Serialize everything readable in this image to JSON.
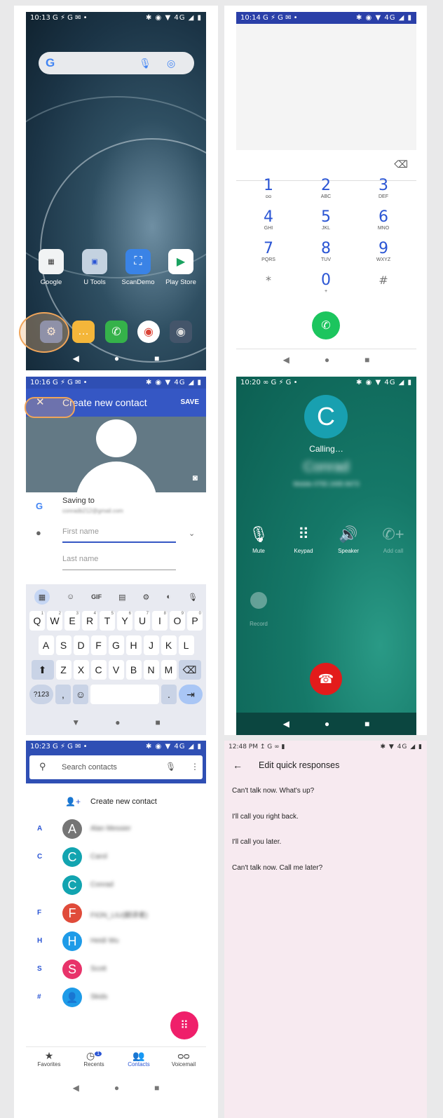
{
  "home": {
    "status": {
      "time": "10:13 G",
      "icons": "⚡ G ✉ •",
      "right": "✱ ◉ ▼ 4G ◢ ▮"
    },
    "apps": [
      {
        "label": "Google",
        "icon": "google-folder-icon"
      },
      {
        "label": "U Tools",
        "icon": "utools-folder-icon"
      },
      {
        "label": "ScanDemo",
        "icon": "scan-icon"
      },
      {
        "label": "Play Store",
        "icon": "play-store-icon"
      }
    ],
    "dock": [
      "settings-icon",
      "messages-icon",
      "phone-icon",
      "chrome-icon",
      "camera-icon"
    ]
  },
  "dialer": {
    "status": {
      "time": "10:14 G",
      "icons": "⚡ G ✉ •",
      "right": "✱ ◉ ▼ 4G ◢ ▮"
    },
    "keys": [
      {
        "d": "1",
        "l": "ᴑᴑ"
      },
      {
        "d": "2",
        "l": "ABC"
      },
      {
        "d": "3",
        "l": "DEF"
      },
      {
        "d": "4",
        "l": "GHI"
      },
      {
        "d": "5",
        "l": "JKL"
      },
      {
        "d": "6",
        "l": "MNO"
      },
      {
        "d": "7",
        "l": "PQRS"
      },
      {
        "d": "8",
        "l": "TUV"
      },
      {
        "d": "9",
        "l": "WXYZ"
      },
      {
        "d": "*",
        "l": ""
      },
      {
        "d": "0",
        "l": "+"
      },
      {
        "d": "#",
        "l": ""
      }
    ]
  },
  "contact_form": {
    "status": {
      "time": "10:16 G",
      "icons": "⚡ G ✉ •",
      "right": "✱ ◉ ▼ 4G ◢ ▮"
    },
    "title": "Create new contact",
    "save": "SAVE",
    "saving_to": "Saving to",
    "account": "conradb212@gmail.com",
    "first_name_placeholder": "First name",
    "last_name_placeholder": "Last name",
    "kb_row1": [
      [
        "Q",
        "1"
      ],
      [
        "W",
        "2"
      ],
      [
        "E",
        "3"
      ],
      [
        "R",
        "4"
      ],
      [
        "T",
        "5"
      ],
      [
        "Y",
        "6"
      ],
      [
        "U",
        "7"
      ],
      [
        "I",
        "8"
      ],
      [
        "O",
        "9"
      ],
      [
        "P",
        "0"
      ]
    ],
    "kb_row2": [
      "A",
      "S",
      "D",
      "F",
      "G",
      "H",
      "J",
      "K",
      "L"
    ],
    "kb_row3": [
      "Z",
      "X",
      "C",
      "V",
      "B",
      "N",
      "M"
    ],
    "sym": "?123",
    "comma": ",",
    "period": ".",
    "gif": "GIF"
  },
  "calling": {
    "status": {
      "time": "10:20 ∞ G",
      "icons": "⚡ G •",
      "right": "✱ ◉ ▼ 4G ◢ ▮"
    },
    "avatar_letter": "C",
    "state": "Calling…",
    "name": "Conrad",
    "number": "Mobile 0755 2495 8473",
    "buttons": [
      {
        "label": "Mute",
        "icon": "mic-off-icon"
      },
      {
        "label": "Keypad",
        "icon": "keypad-icon"
      },
      {
        "label": "Speaker",
        "icon": "speaker-icon"
      },
      {
        "label": "Add call",
        "icon": "add-call-icon"
      }
    ],
    "record": "Record"
  },
  "contacts": {
    "status": {
      "time": "10:23 G",
      "icons": "⚡ G ✉ •",
      "right": "✱ ◉ ▼ 4G ◢ ▮"
    },
    "search_placeholder": "Search contacts",
    "create": "Create new contact",
    "rows": [
      {
        "letter": "A",
        "initial": "A",
        "name": "Alan Messier",
        "color": "#757575"
      },
      {
        "letter": "C",
        "initial": "C",
        "name": "Carol",
        "color": "#12a4b0"
      },
      {
        "letter": "",
        "initial": "C",
        "name": "Conrad",
        "color": "#12a4b0"
      },
      {
        "letter": "F",
        "initial": "F",
        "name": "FION_LIU(翻译者)",
        "color": "#e04b3a"
      },
      {
        "letter": "H",
        "initial": "H",
        "name": "Heidi Wu",
        "color": "#1e9be8"
      },
      {
        "letter": "S",
        "initial": "S",
        "name": "Scott",
        "color": "#e8336a"
      },
      {
        "letter": "#",
        "initial": "",
        "name": "Skids",
        "color": "#1e9be8"
      }
    ],
    "tabs": [
      {
        "label": "Favorites",
        "icon": "star-icon"
      },
      {
        "label": "Recents",
        "icon": "clock-icon",
        "badge": "1"
      },
      {
        "label": "Contacts",
        "icon": "people-icon"
      },
      {
        "label": "Voicemail",
        "icon": "voicemail-icon"
      }
    ]
  },
  "quick": {
    "status": {
      "time": "12:48 PM",
      "icons": "↥ G ∞ ▮",
      "right": "✱ ▼ 4G ◢ ▮"
    },
    "title": "Edit quick responses",
    "responses": [
      "Can't talk now. What's up?",
      "I'll call you right back.",
      "I'll call you later.",
      "Can't talk now. Call me later?"
    ]
  }
}
